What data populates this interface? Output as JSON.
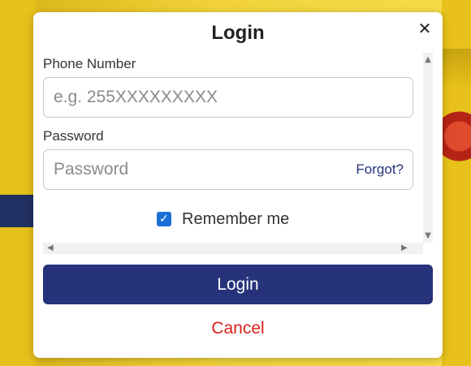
{
  "modal": {
    "title": "Login",
    "close_symbol": "✕"
  },
  "form": {
    "phone_label": "Phone Number",
    "phone_placeholder": "e.g. 255XXXXXXXXX",
    "password_label": "Password",
    "password_placeholder": "Password",
    "forgot_label": "Forgot?",
    "remember_label": "Remember me",
    "remember_checked": true
  },
  "actions": {
    "login_label": "Login",
    "cancel_label": "Cancel"
  },
  "scrollbar": {
    "up_arrow": "▲",
    "down_arrow": "▼",
    "left_arrow": "◀",
    "right_arrow": "▶"
  },
  "colors": {
    "primary": "#26327a",
    "cancel": "#d8201a",
    "checkbox": "#1a6fd6"
  }
}
